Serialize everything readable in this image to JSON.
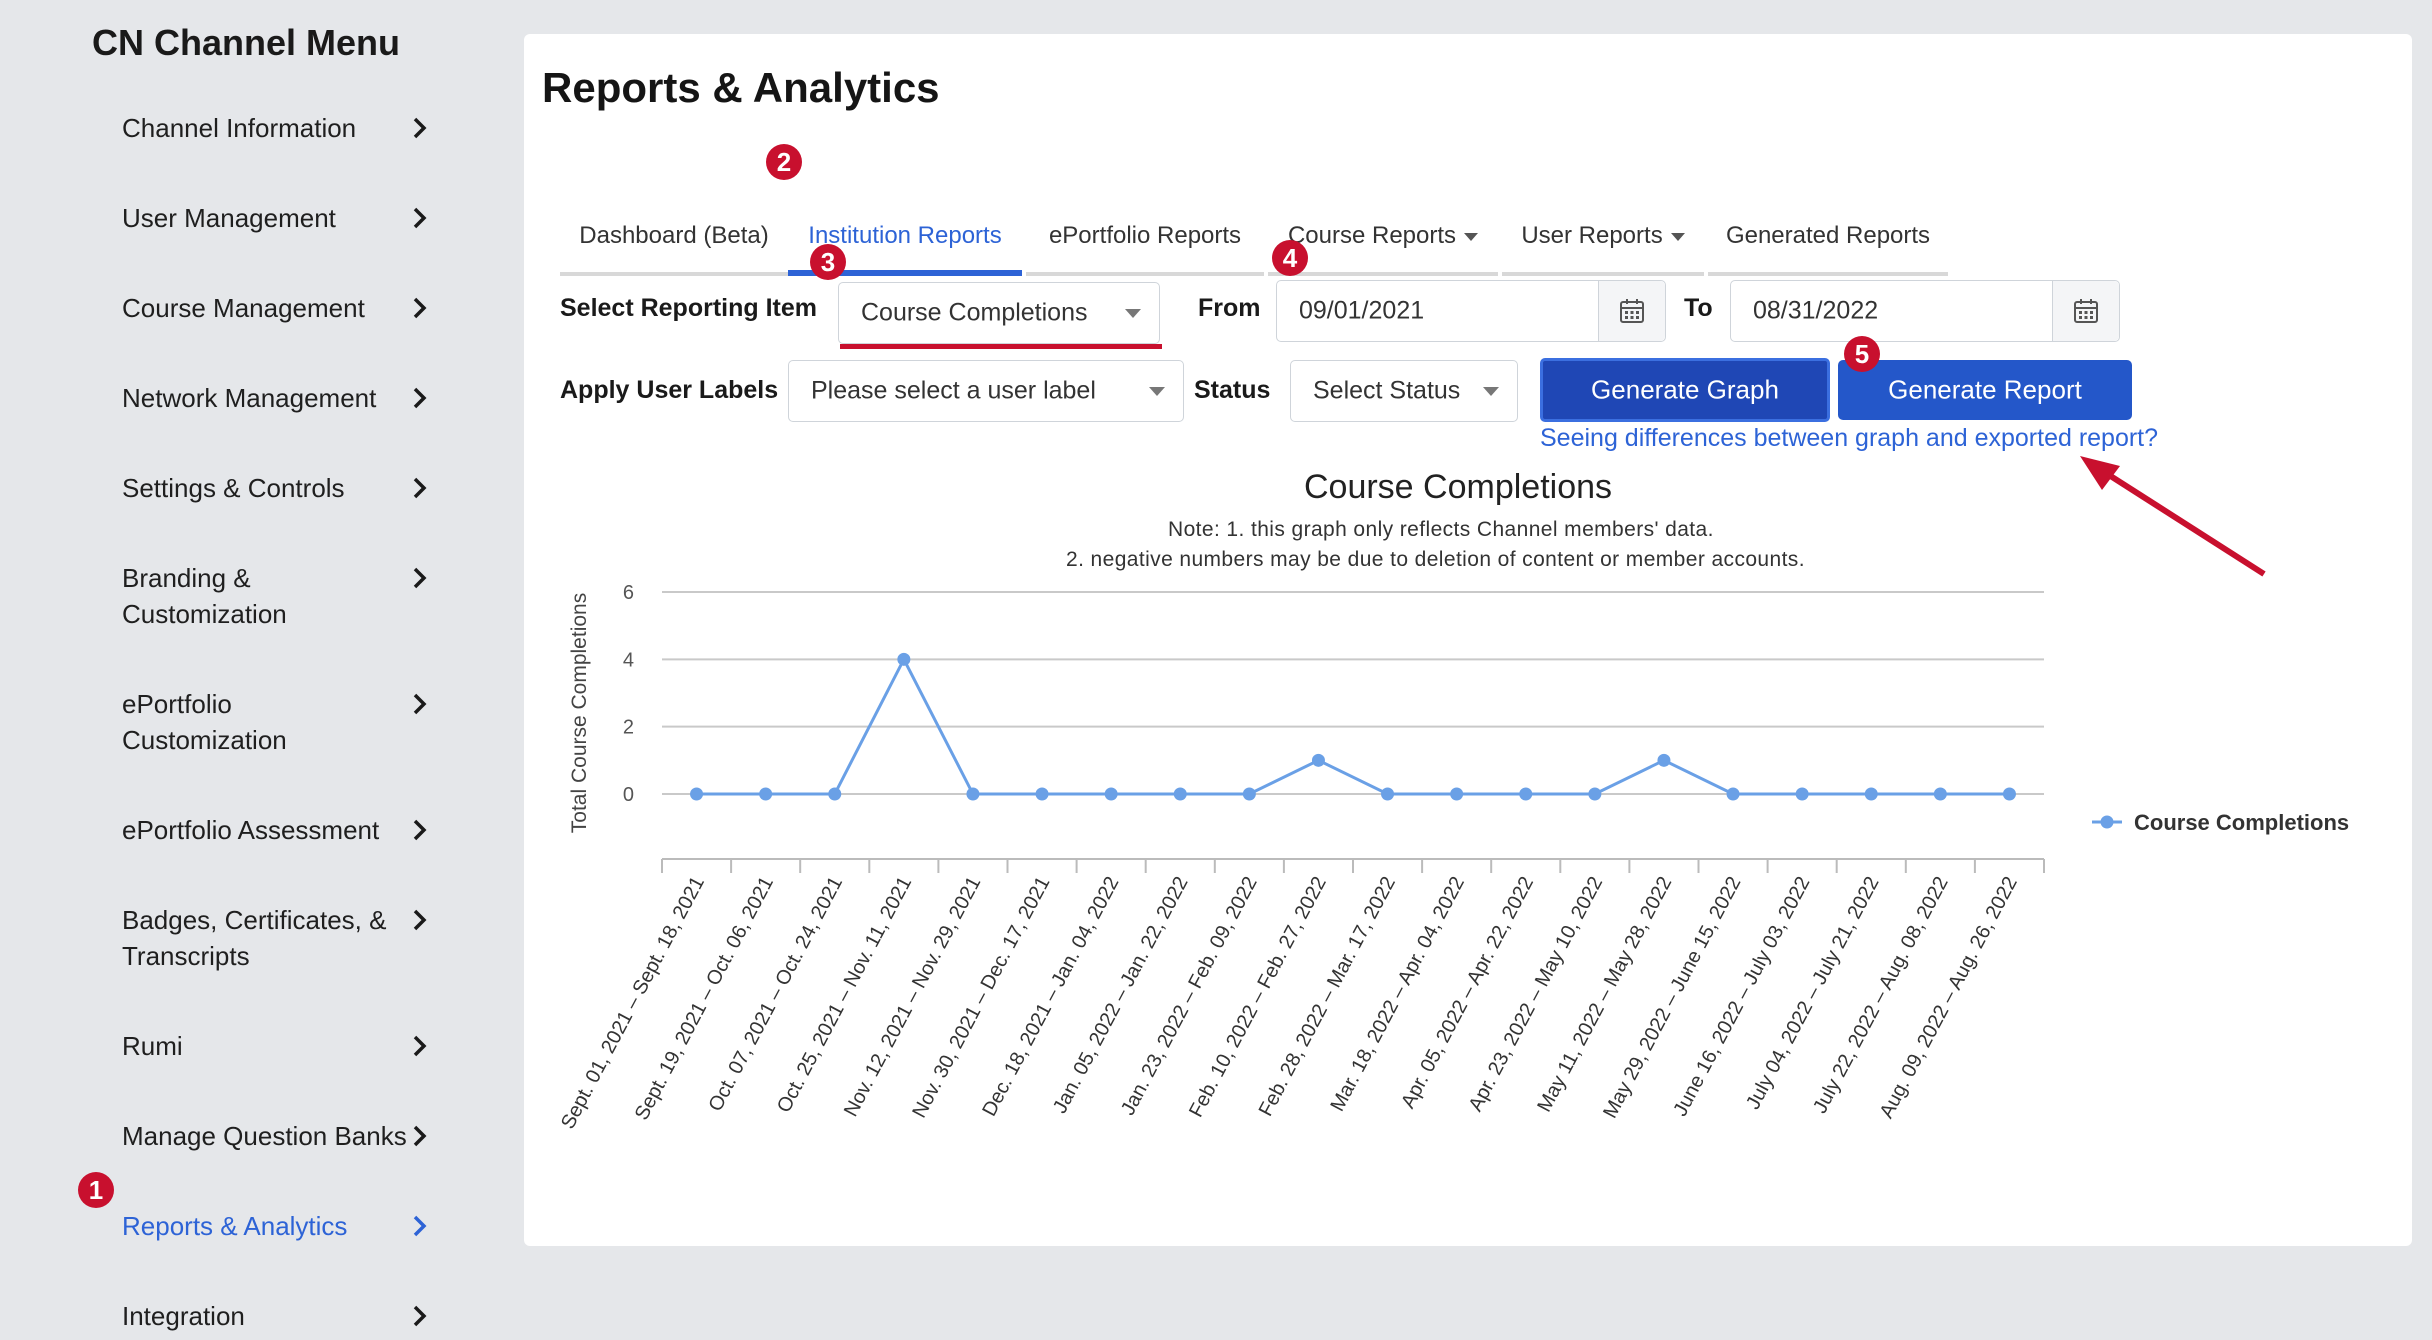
{
  "sidebar": {
    "title": "CN Channel Menu",
    "items": [
      {
        "label": "Channel Information"
      },
      {
        "label": "User Management"
      },
      {
        "label": "Course Management"
      },
      {
        "label": "Network Management"
      },
      {
        "label": "Settings & Controls"
      },
      {
        "label": "Branding & Customization"
      },
      {
        "label": "ePortfolio Customization"
      },
      {
        "label": "ePortfolio Assessment"
      },
      {
        "label": "Badges, Certificates, & Transcripts"
      },
      {
        "label": "Rumi"
      },
      {
        "label": "Manage Question Banks"
      },
      {
        "label": "Reports & Analytics",
        "active": true
      },
      {
        "label": "Integration"
      }
    ]
  },
  "main": {
    "title": "Reports & Analytics",
    "tabs": [
      {
        "label": "Dashboard (Beta)"
      },
      {
        "label": "Institution Reports",
        "active": true
      },
      {
        "label": "ePortfolio Reports"
      },
      {
        "label": "Course Reports"
      },
      {
        "label": "User Reports"
      },
      {
        "label": "Generated Reports"
      }
    ],
    "filters": {
      "reporting_item_label": "Select Reporting Item",
      "reporting_item_value": "Course Completions",
      "from_label": "From",
      "from_value": "09/01/2021",
      "to_label": "To",
      "to_value": "08/31/2022",
      "user_labels_label": "Apply User Labels",
      "user_labels_placeholder": "Please select a user label",
      "status_label": "Status",
      "status_placeholder": "Select Status"
    },
    "buttons": {
      "generate_graph": "Generate Graph",
      "generate_report": "Generate Report"
    },
    "diff_link": "Seeing differences between graph and exported report?"
  },
  "badges": [
    "1",
    "2",
    "3",
    "4",
    "5"
  ],
  "colors": {
    "accent": "#2d63d6",
    "button": "#2457c9",
    "badge": "#c8102e",
    "series": "#6aa0e6",
    "annotation": "#c8102e"
  },
  "chart_data": {
    "type": "line",
    "title": "Course Completions",
    "notes": [
      "Note: 1. this graph only reflects Channel members' data.",
      "2. negative numbers may be due to deletion of content or member accounts."
    ],
    "ylabel": "Total Course Completions",
    "ylim": [
      0,
      6
    ],
    "yticks": [
      0,
      2,
      4,
      6
    ],
    "grid": true,
    "legend_position": "right",
    "categories": [
      "Sept. 01, 2021 – Sept. 18, 2021",
      "Sept. 19, 2021 – Oct. 06, 2021",
      "Oct. 07, 2021 – Oct. 24, 2021",
      "Oct. 25, 2021 – Nov. 11, 2021",
      "Nov. 12, 2021 – Nov. 29, 2021",
      "Nov. 30, 2021 – Dec. 17, 2021",
      "Dec. 18, 2021 – Jan. 04, 2022",
      "Jan. 05, 2022 – Jan. 22, 2022",
      "Jan. 23, 2022 – Feb. 09, 2022",
      "Feb. 10, 2022 – Feb. 27, 2022",
      "Feb. 28, 2022 – Mar. 17, 2022",
      "Mar. 18, 2022 – Apr. 04, 2022",
      "Apr. 05, 2022 – Apr. 22, 2022",
      "Apr. 23, 2022 – May 10, 2022",
      "May 11, 2022 – May 28, 2022",
      "May 29, 2022 – June 15, 2022",
      "June 16, 2022 – July 03, 2022",
      "July 04, 2022 – July 21, 2022",
      "July 22, 2022 – Aug. 08, 2022",
      "Aug. 09, 2022 – Aug. 26, 2022"
    ],
    "series": [
      {
        "name": "Course Completions",
        "values": [
          0,
          0,
          0,
          4,
          0,
          0,
          0,
          0,
          0,
          1,
          0,
          0,
          0,
          0,
          1,
          0,
          0,
          0,
          0,
          0
        ]
      }
    ]
  }
}
